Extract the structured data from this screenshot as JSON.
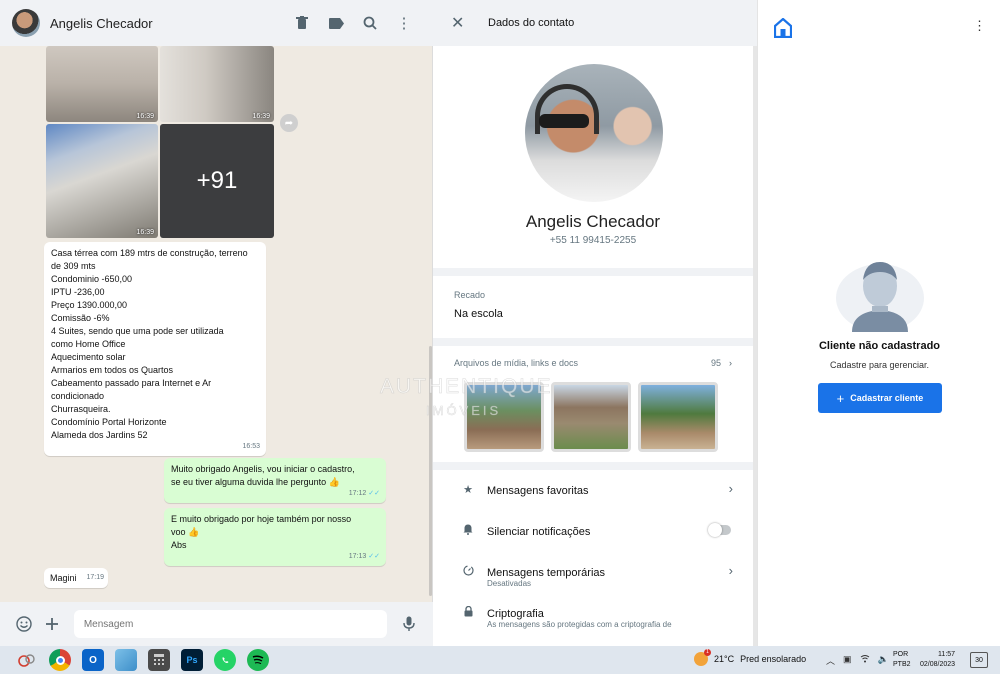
{
  "chat": {
    "contact_name": "Angelis Checador",
    "photos": {
      "times": [
        "16:39",
        "16:39",
        "16:39"
      ],
      "more_count": "+91"
    },
    "description_lines": [
      "Casa térrea com 189 mtrs de construção, terreno",
      "de 309 mts",
      "Condominio -650,00",
      "IPTU -236,00",
      "Preço 1390.000,00",
      "Comissão -6%",
      "4 Suites, sendo que uma pode ser utilizada",
      "como Home Office",
      "Aquecimento solar",
      "Armarios em todos os Quartos",
      "Cabeamento passado para Internet e Ar",
      "condicionado",
      "Churrasqueira.",
      "Condomínio Portal Horizonte",
      "Alameda dos Jardins 52"
    ],
    "description_time": "16:53",
    "outgoing": [
      {
        "lines": [
          "Muito obrigado Angelis, vou iniciar o cadastro,",
          "se eu tiver alguma duvida lhe pergunto 👍"
        ],
        "time": "17:12"
      },
      {
        "lines": [
          "E muito obrigado por hoje também por nosso",
          "voo 👍",
          "Abs"
        ],
        "time": "17:13"
      }
    ],
    "incoming_last": {
      "text": "Magini",
      "time": "17:19"
    },
    "compose_placeholder": "Mensagem"
  },
  "contact": {
    "header_title": "Dados do contato",
    "name": "Angelis Checador",
    "phone": "+55 11 99415-2255",
    "about_label": "Recado",
    "about_value": "Na escola",
    "media_label": "Arquivos de mídia, links e docs",
    "media_count": "95",
    "options": [
      {
        "label": "Mensagens favoritas",
        "icon": "star-icon"
      },
      {
        "label": "Silenciar notificações",
        "icon": "bell-icon"
      },
      {
        "label": "Mensagens temporárias",
        "sub": "Desativadas",
        "icon": "timer-icon"
      },
      {
        "label": "Criptografia",
        "sub": "As mensagens são protegidas com a criptografia de",
        "icon": "lock-icon"
      }
    ],
    "mute_enabled": false,
    "watermark": [
      "AUTHENTIQUE",
      "IMÓVEIS"
    ]
  },
  "crm": {
    "title": "Cliente não cadastrado",
    "subtitle": "Cadastre para gerenciar.",
    "button_label": "Cadastrar cliente"
  },
  "taskbar": {
    "weather_temp": "21°C",
    "weather_text": "Pred ensolarado",
    "weather_badge": "1",
    "lang_top": "POR",
    "lang_bottom": "PTB2",
    "time": "11:57",
    "date": "02/08/2023",
    "notifications": "30"
  },
  "colors": {
    "accent": "#1a73e8",
    "outgoing_bubble": "#d9fdd3",
    "chat_bg": "#efeae2"
  }
}
